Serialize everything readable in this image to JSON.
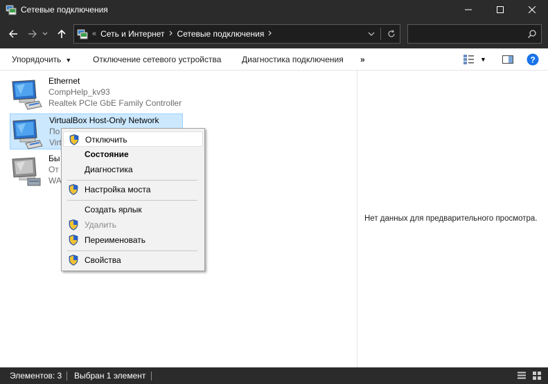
{
  "window": {
    "title": "Сетевые подключения"
  },
  "address_bar": {
    "prefix": "«",
    "breadcrumbs": [
      "Сеть и Интернет",
      "Сетевые подключения"
    ]
  },
  "search": {
    "placeholder": ""
  },
  "commands": {
    "organize": "Упорядочить",
    "disable_device": "Отключение сетевого устройства",
    "diagnose": "Диагностика подключения",
    "more": "»"
  },
  "connections": [
    {
      "name": "Ethernet",
      "status": "CompHelp_kv93",
      "device": "Realtek PCIe GbE Family Controller"
    },
    {
      "name": "VirtualBox Host-Only Network",
      "status": "По",
      "device": "Virt"
    },
    {
      "name": "Бы",
      "status": "От",
      "device": "WA"
    }
  ],
  "context_menu": {
    "items": [
      {
        "label": "Отключить",
        "shield": true,
        "bold": false,
        "disabled": false,
        "hover": true
      },
      {
        "label": "Состояние",
        "shield": false,
        "bold": true,
        "disabled": false,
        "hover": false
      },
      {
        "label": "Диагностика",
        "shield": false,
        "bold": false,
        "disabled": false,
        "hover": false
      },
      {
        "label": "Настройка моста",
        "shield": true,
        "bold": false,
        "disabled": false,
        "hover": false
      },
      {
        "label": "Создать ярлык",
        "shield": false,
        "bold": false,
        "disabled": false,
        "hover": false
      },
      {
        "label": "Удалить",
        "shield": true,
        "bold": false,
        "disabled": true,
        "hover": false
      },
      {
        "label": "Переименовать",
        "shield": true,
        "bold": false,
        "disabled": false,
        "hover": false
      },
      {
        "label": "Свойства",
        "shield": true,
        "bold": false,
        "disabled": false,
        "hover": false
      }
    ]
  },
  "preview": {
    "empty_text": "Нет данных для предварительного просмотра."
  },
  "status_bar": {
    "item_count": "Элементов: 3",
    "selected": "Выбран 1 элемент"
  },
  "colors": {
    "chrome_dark": "#2b2b2b",
    "selection_bg": "#cce8ff",
    "selection_border": "#99d1ff",
    "menu_bg": "#f2f2f2",
    "help_blue": "#1a73e8"
  }
}
